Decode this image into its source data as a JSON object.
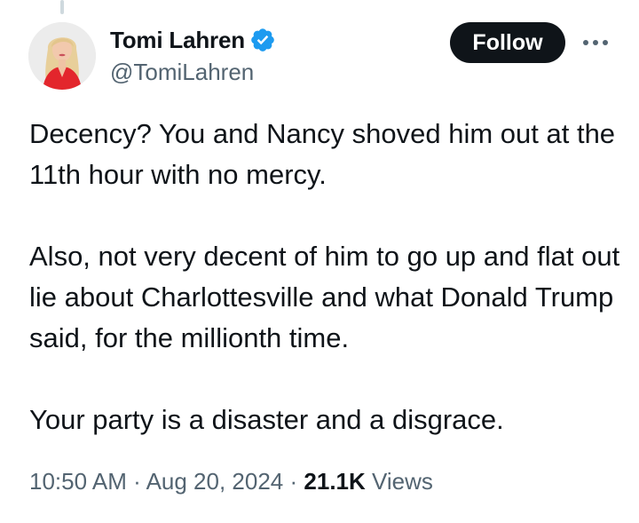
{
  "author": {
    "display_name": "Tomi Lahren",
    "handle": "@TomiLahren",
    "verified": true,
    "verified_color": "#1d9bf0"
  },
  "actions": {
    "follow_label": "Follow",
    "more_icon": "more-horizontal-icon"
  },
  "tweet": {
    "paragraphs": [
      "Decency? You and Nancy shoved him out at the 11th hour with no mercy.",
      "Also, not very decent of him to go up and flat out lie about Charlottesville and what Donald Trump said, for the millionth time.",
      "Your party is a disaster and a disgrace."
    ]
  },
  "meta": {
    "time": "10:50 AM",
    "separator": "·",
    "date": "Aug 20, 2024",
    "views_count": "21.1K",
    "views_label": "Views"
  },
  "colors": {
    "text_primary": "#0f1419",
    "text_secondary": "#536471",
    "button_bg": "#0f1419",
    "thread_line": "#cfd9de"
  }
}
